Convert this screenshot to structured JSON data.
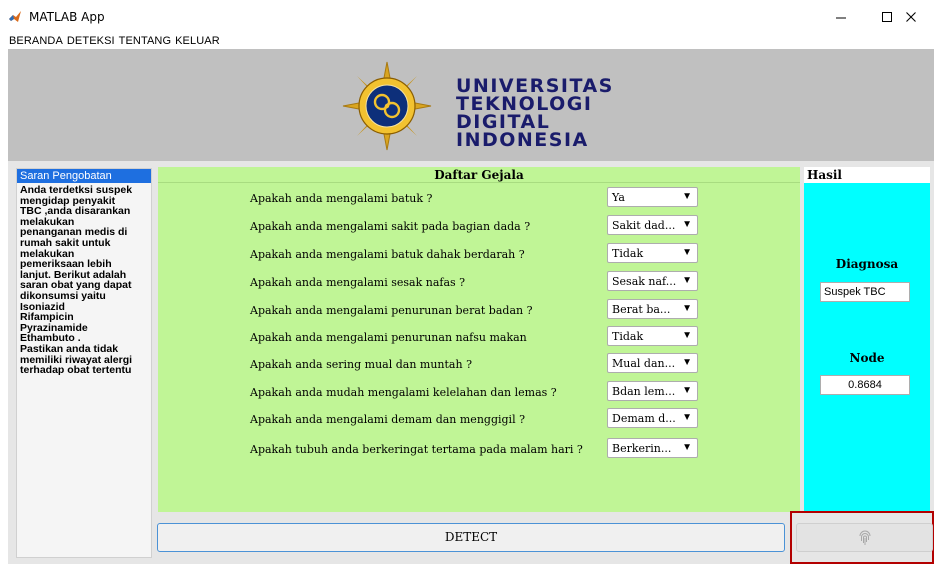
{
  "window": {
    "title": "MATLAB App"
  },
  "menu": [
    "BERANDA",
    "DETEKSI",
    "TENTANG",
    "KELUAR"
  ],
  "logo": {
    "lines": [
      "UNIVERSITAS",
      "TEKNOLOGI",
      "DIGITAL",
      "INDONESIA"
    ],
    "emblem_text": "UNIVERSITAS TEKNOLOGI DIGITAL INDONESIA"
  },
  "left_panel": {
    "title": "Saran Pengobatan",
    "text": "Anda terdetksi suspek\nmengidap penyakit\nTBC ,anda disarankan\nmelakukan\npenanganan medis di\nrumah sakit untuk\nmelakukan\npemeriksaan lebih\nlanjut. Berikut adalah\nsaran obat yang dapat\ndikonsumsi yaitu\nIsoniazid\nRifampicin\nPyrazinamide\nEthambuto .\nPastikan anda tidak\nmemiliki riwayat alergi\nterhadap obat tertentu"
  },
  "center_panel": {
    "title": "Daftar Gejala",
    "questions": [
      {
        "label": "Apakah anda mengalami batuk ?",
        "value": "Ya"
      },
      {
        "label": "Apakah anda mengalami sakit pada bagian dada ?",
        "value": "Sakit dad..."
      },
      {
        "label": "Apakah anda mengalami batuk dahak berdarah ?",
        "value": "Tidak"
      },
      {
        "label": "Apakah anda mengalami sesak nafas ?",
        "value": "Sesak naf..."
      },
      {
        "label": "Apakah anda mengalami penurunan berat badan ?",
        "value": "Berat ba..."
      },
      {
        "label": "Apakah anda mengalami penurunan nafsu makan",
        "value": "Tidak"
      },
      {
        "label": "Apakah anda sering mual dan muntah ?",
        "value": "Mual dan..."
      },
      {
        "label": "Apakah anda mudah mengalami kelelahan dan lemas ?",
        "value": "Bdan lem..."
      },
      {
        "label": "Apakah anda mengalami demam dan menggigil ?",
        "value": "Demam d..."
      },
      {
        "label": "Apakah tubuh  anda berkeringat tertama pada malam hari ?",
        "value": "Berkerin..."
      }
    ]
  },
  "right_panel": {
    "title": "Hasil",
    "diagnosa_label": "Diagnosa",
    "diagnosa_value": "Suspek TBC",
    "node_label": "Node",
    "node_value": "0.8684"
  },
  "buttons": {
    "detect_label": "DETECT",
    "fingerprint_icon": "fingerprint-icon"
  },
  "colors": {
    "symptom_panel": "#c0f596",
    "result_panel": "#00ffff",
    "left_header": "#1e6fe0",
    "highlight": "#b30000",
    "logo_text": "#1a1c6b"
  }
}
